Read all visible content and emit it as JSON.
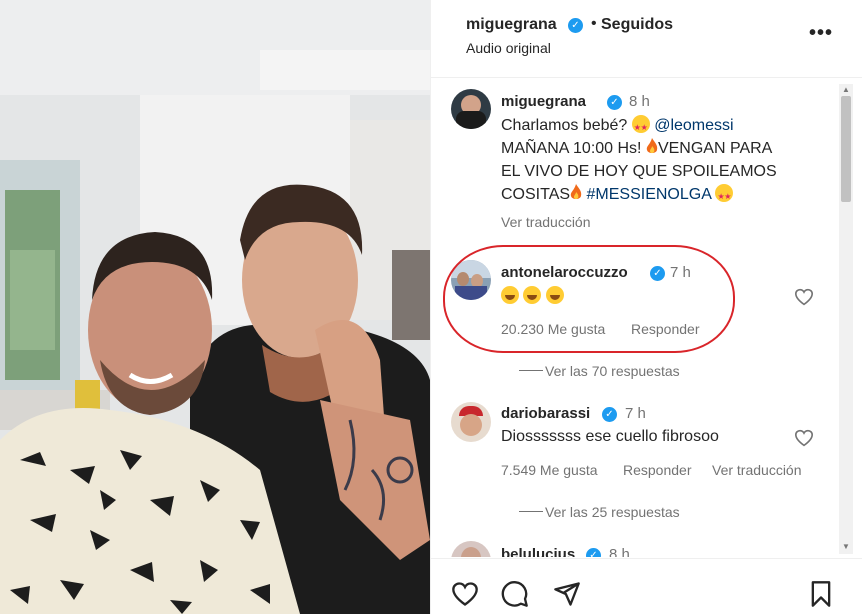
{
  "post": {
    "username": "miguegrana",
    "dot": "•",
    "follow_status": "Seguidos",
    "audio": "Audio original",
    "more_icon": "more-horizontal-icon"
  },
  "caption": {
    "username": "miguegrana",
    "time": "8 h",
    "line1": "Charlamos bebé? ",
    "mention": "@leomessi",
    "line2": "MAÑANA 10:00 Hs! ",
    "line2b": "VENGAN PARA",
    "line3": "EL VIVO DE HOY QUE SPOILEAMOS",
    "line4a": "COSITAS",
    "hashtag": "#MESSIENOLGA",
    "translate": "Ver traducción"
  },
  "comments": [
    {
      "username": "antonelaroccuzzo",
      "time": "7 h",
      "likes": "20.230 Me gusta",
      "reply": "Responder",
      "view_replies": "Ver las 70 respuestas"
    },
    {
      "username": "dariobarassi",
      "time": "7 h",
      "text": "Diosssssss ese cuello fibrosoo",
      "likes": "7.549 Me gusta",
      "reply": "Responder",
      "translate": "Ver traducción",
      "view_replies": "Ver las 25 respuestas"
    },
    {
      "username": "belulucius",
      "time": "8 h"
    }
  ],
  "colors": {
    "verified": "#1d9bf0",
    "highlight_ring": "#d9252a",
    "link": "#00376b",
    "muted": "#737373"
  },
  "icons": {
    "like": "heart-icon",
    "comment": "comment-icon",
    "share": "send-icon",
    "save": "bookmark-icon"
  }
}
